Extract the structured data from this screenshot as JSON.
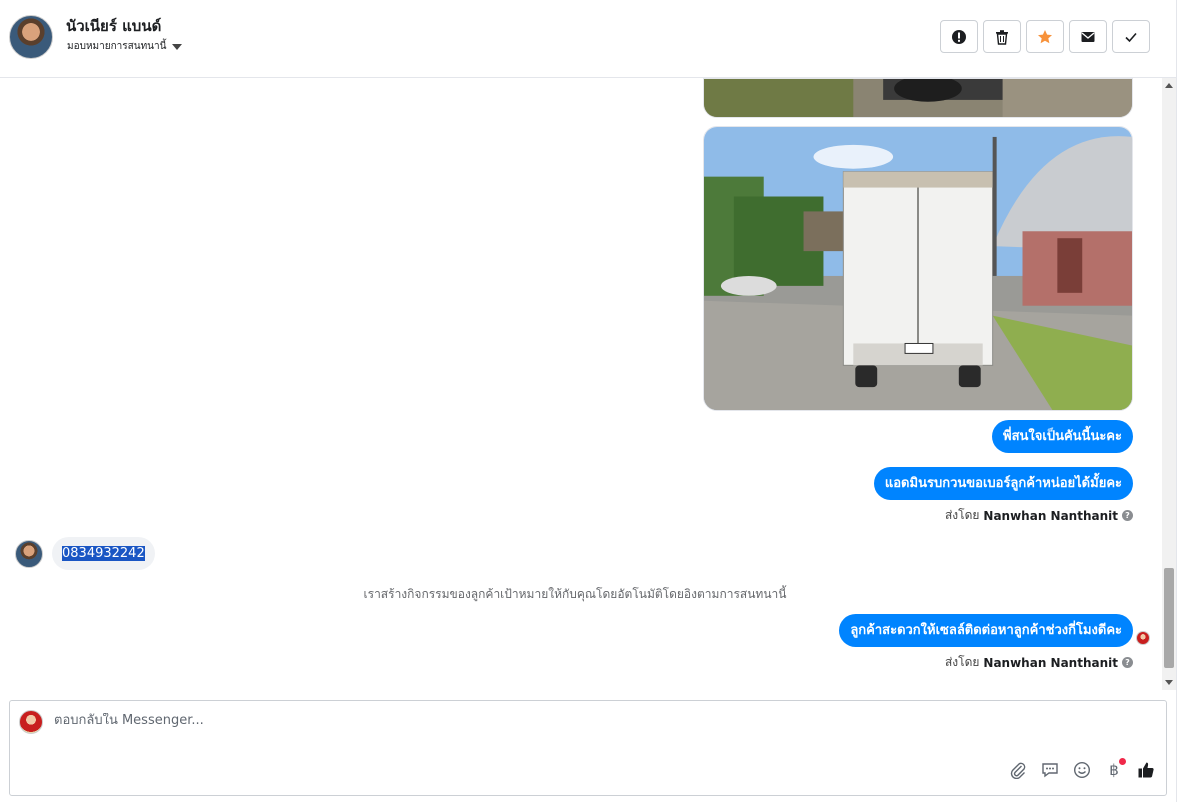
{
  "header": {
    "contact_name": "นัวเนียร์ แบนด์",
    "assign_label": "มอบหมายการสนทนานี้",
    "actions": [
      "mark-spam",
      "delete",
      "star",
      "mark-unread",
      "mark-done"
    ]
  },
  "colors": {
    "accent": "#0084ff",
    "star": "#f7923b",
    "incoming_bubble": "#f0f2f5"
  },
  "messages": {
    "out_1": "พี่สนใจเป็นคันนี้นะคะ",
    "out_2": "แอดมินรบกวนขอเบอร์ลูกค้าหน่อยได้มั้ยคะ",
    "sent_by_label_1": "ส่งโดย",
    "sent_by_name_1": "Nanwhan Nanthanit",
    "in_1": "0834932242",
    "system_note": "เราสร้างกิจกรรมของลูกค้าเป้าหมายให้กับคุณโดยอัตโนมัติโดยอิงตามการสนทนานี้",
    "out_3": "ลูกค้าสะดวกให้เซลล์ติดต่อหาลูกค้าช่วงกี่โมงดีคะ",
    "sent_by_label_2": "ส่งโดย",
    "sent_by_name_2": "Nanwhan Nanthanit"
  },
  "composer": {
    "placeholder": "ตอบกลับใน Messenger...",
    "tools": [
      "attach-icon",
      "saved-reply-icon",
      "emoji-icon",
      "payment-icon",
      "like-icon"
    ],
    "payment_symbol": "฿"
  }
}
